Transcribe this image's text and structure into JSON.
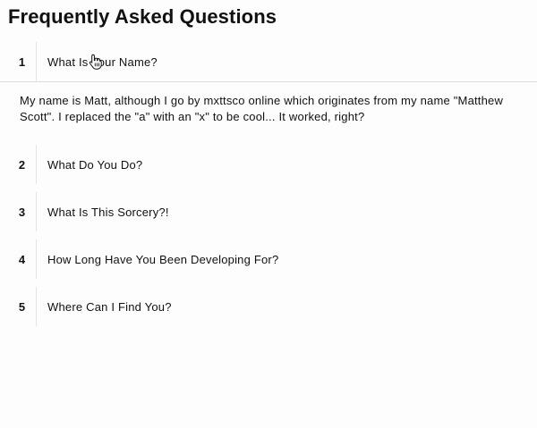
{
  "page": {
    "title": "Frequently Asked Questions"
  },
  "faq": {
    "items": [
      {
        "number": "1",
        "question": "What Is Your Name?",
        "answer": "My name is Matt, although I go by mxttsco online which originates from my name \"Matthew Scott\". I replaced the \"a\" with an \"x\" to be cool... It worked, right?",
        "expanded": true
      },
      {
        "number": "2",
        "question": "What Do You Do?",
        "expanded": false
      },
      {
        "number": "3",
        "question": "What Is This Sorcery?!",
        "expanded": false
      },
      {
        "number": "4",
        "question": "How Long Have You Been Developing For?",
        "expanded": false
      },
      {
        "number": "5",
        "question": "Where Can I Find You?",
        "expanded": false
      }
    ]
  },
  "cursor": {
    "icon": "hand-pointer-icon"
  }
}
